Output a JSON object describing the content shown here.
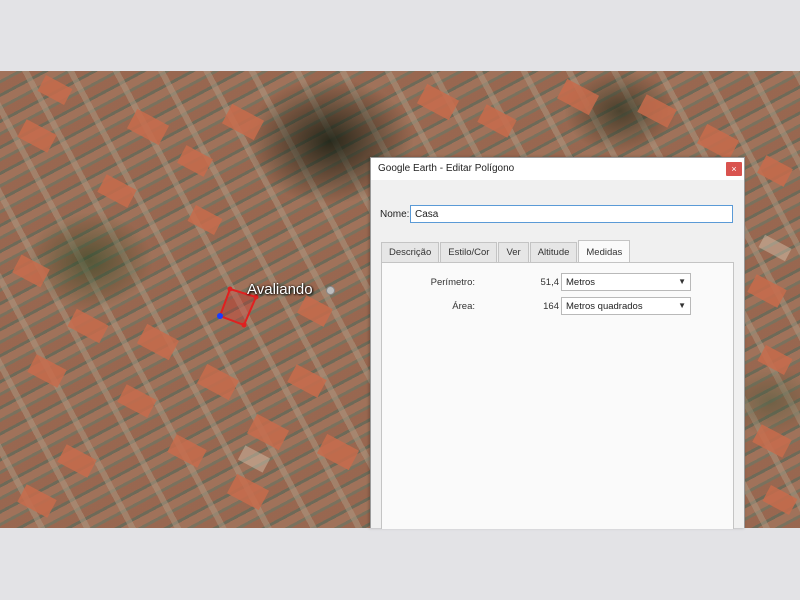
{
  "map": {
    "placemark_label": "Avaliando"
  },
  "dialog": {
    "title": "Google Earth - Editar Polígono",
    "close_glyph": "×",
    "name_label": "Nome:",
    "name_value": "Casa",
    "tabs": [
      {
        "label": "Descrição",
        "active": false
      },
      {
        "label": "Estilo/Cor",
        "active": false
      },
      {
        "label": "Ver",
        "active": false
      },
      {
        "label": "Altitude",
        "active": false
      },
      {
        "label": "Medidas",
        "active": true
      }
    ],
    "measurements": {
      "perimeter": {
        "label": "Perímetro:",
        "value": "51,4",
        "unit": "Metros"
      },
      "area": {
        "label": "Área:",
        "value": "164",
        "unit": "Metros quadrados"
      }
    }
  },
  "colors": {
    "close_button": "#d9534f",
    "input_focus_border": "#5a9ad6",
    "polygon_outline": "#e02020",
    "polygon_vertex": "#1a3cff"
  },
  "icons": {
    "close": "close-icon",
    "dropdown": "chevron-down-icon"
  }
}
